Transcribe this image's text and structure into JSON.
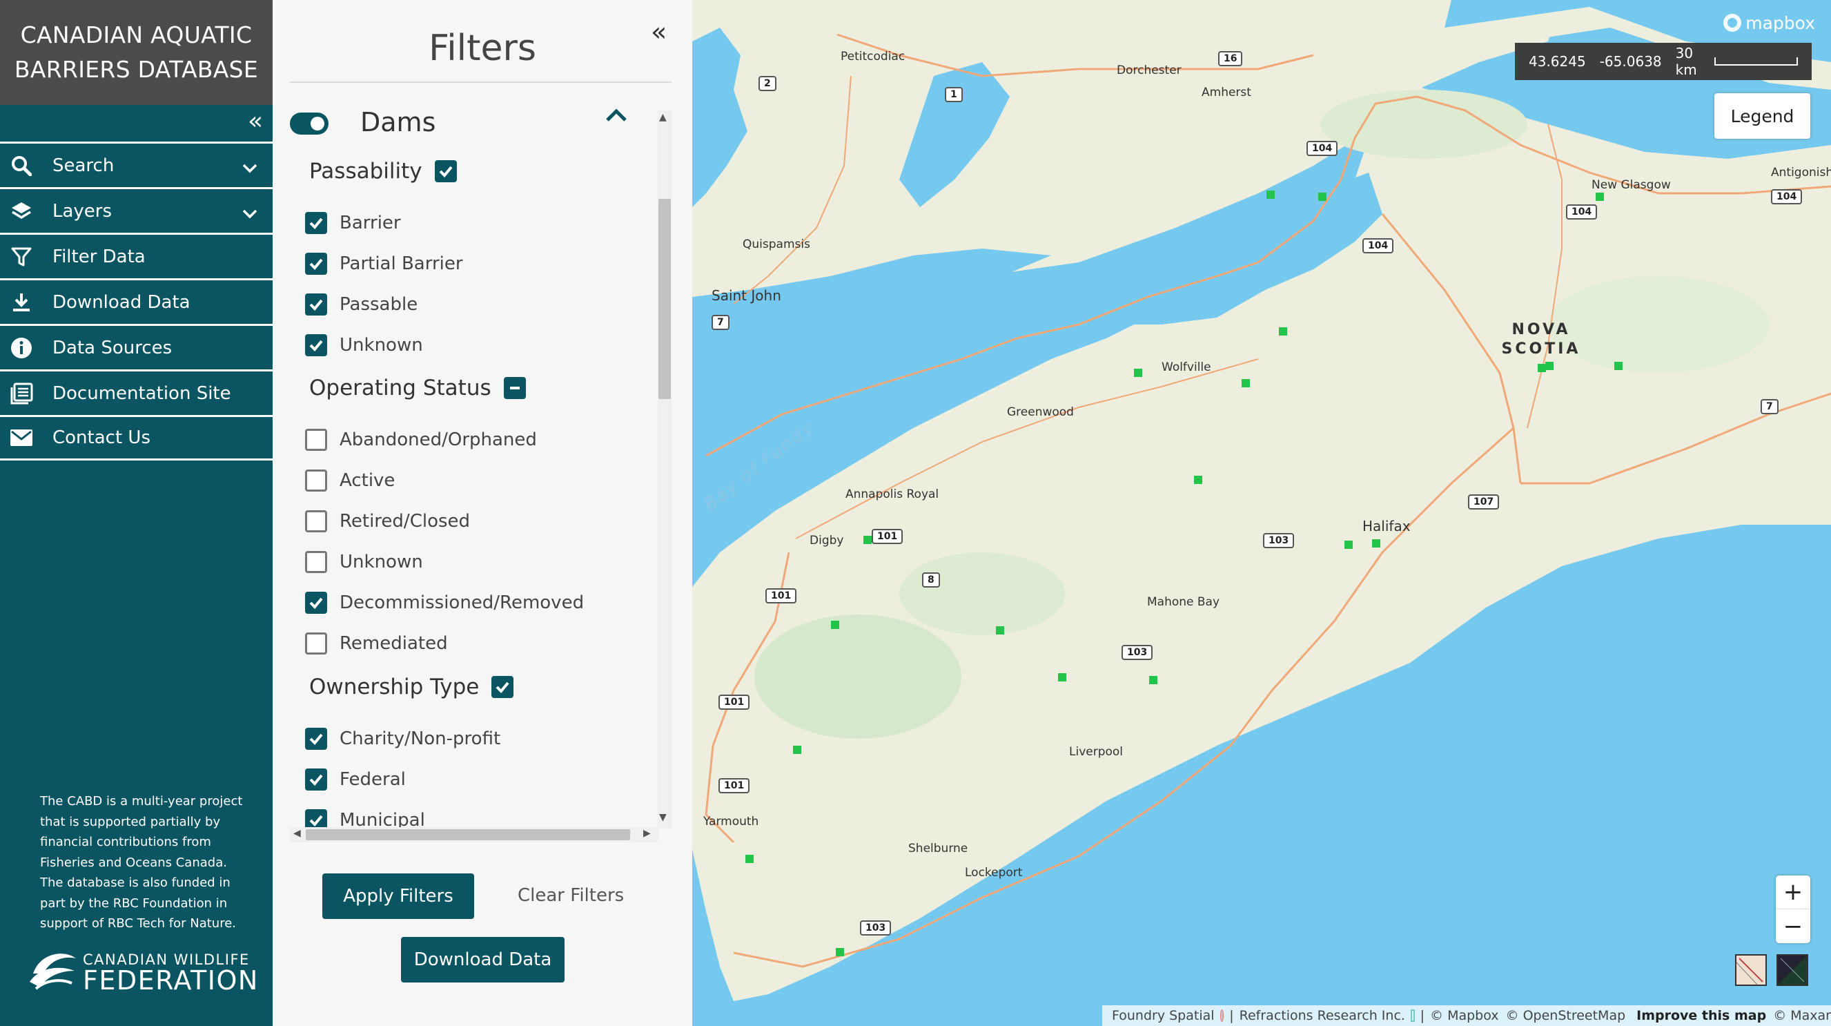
{
  "sidebar": {
    "brand_title_line1": "CANADIAN AQUATIC",
    "brand_title_line2": "BARRIERS DATABASE",
    "nav": [
      {
        "label": "Search",
        "icon": "search-icon",
        "has_caret": true
      },
      {
        "label": "Layers",
        "icon": "layers-icon",
        "has_caret": true
      },
      {
        "label": "Filter Data",
        "icon": "filter-icon"
      },
      {
        "label": "Download Data",
        "icon": "download-icon"
      },
      {
        "label": "Data Sources",
        "icon": "info-icon"
      },
      {
        "label": "Documentation Site",
        "icon": "documentation-icon"
      },
      {
        "label": "Contact Us",
        "icon": "mail-icon"
      }
    ],
    "about_text": "The CABD is a multi-year project that is supported partially by financial contributions from Fisheries and Oceans Canada. The database is also funded in part by the RBC Foundation in support of RBC Tech for Nature.",
    "logo_line1": "CANADIAN WILDLIFE",
    "logo_line2": "FEDERATION"
  },
  "filters": {
    "title": "Filters",
    "dams_label": "Dams",
    "dams_enabled": true,
    "passability": {
      "title": "Passability",
      "state": "all",
      "options": [
        {
          "label": "Barrier",
          "checked": true
        },
        {
          "label": "Partial Barrier",
          "checked": true
        },
        {
          "label": "Passable",
          "checked": true
        },
        {
          "label": "Unknown",
          "checked": true
        }
      ]
    },
    "operating_status": {
      "title": "Operating Status",
      "state": "partial",
      "options": [
        {
          "label": "Abandoned/Orphaned",
          "checked": false
        },
        {
          "label": "Active",
          "checked": false
        },
        {
          "label": "Retired/Closed",
          "checked": false
        },
        {
          "label": "Unknown",
          "checked": false
        },
        {
          "label": "Decommissioned/Removed",
          "checked": true
        },
        {
          "label": "Remediated",
          "checked": false
        }
      ]
    },
    "ownership_type": {
      "title": "Ownership Type",
      "state": "all",
      "options": [
        {
          "label": "Charity/Non-profit",
          "checked": true
        },
        {
          "label": "Federal",
          "checked": true
        },
        {
          "label": "Municipal",
          "checked": true
        }
      ]
    },
    "apply_label": "Apply Filters",
    "clear_label": "Clear Filters",
    "download_label": "Download Data"
  },
  "map": {
    "logo": "mapbox",
    "coords": {
      "lat": "43.6245",
      "lon": "-65.0638",
      "scale": "30 km"
    },
    "legend_label": "Legend",
    "zoom_in": "+",
    "zoom_out": "−",
    "labels": {
      "petitcodiac": "Petitcodiac",
      "dorchester": "Dorchester",
      "amherst": "Amherst",
      "antigonish": "Antigonish",
      "new_glasgow": "New Glasgow",
      "quispamsis": "Quispamsis",
      "saint_john": "Saint John",
      "nova": "NOVA",
      "scotia": "SCOTIA",
      "wolfville": "Wolfville",
      "greenwood": "Greenwood",
      "bay_of_fundy": "Bay of Fundy",
      "annapolis_royal": "Annapolis Royal",
      "digby": "Digby",
      "halifax": "Halifax",
      "mahone_bay": "Mahone Bay",
      "liverpool": "Liverpool",
      "yarmouth": "Yarmouth",
      "shelburne": "Shelburne",
      "lockeport": "Lockeport"
    },
    "highways": [
      "2",
      "1",
      "16",
      "104",
      "104",
      "104",
      "104",
      "7",
      "7",
      "107",
      "103",
      "101",
      "8",
      "101",
      "103",
      "101",
      "101",
      "103"
    ],
    "dam_color": "#22c44a",
    "attribution": {
      "foundry": "Foundry Spatial",
      "refractions": "Refractions Research Inc.",
      "mapbox": "© Mapbox",
      "osm": "© OpenStreetMap",
      "improve": "Improve this map",
      "maxar": "© Maxar"
    }
  }
}
